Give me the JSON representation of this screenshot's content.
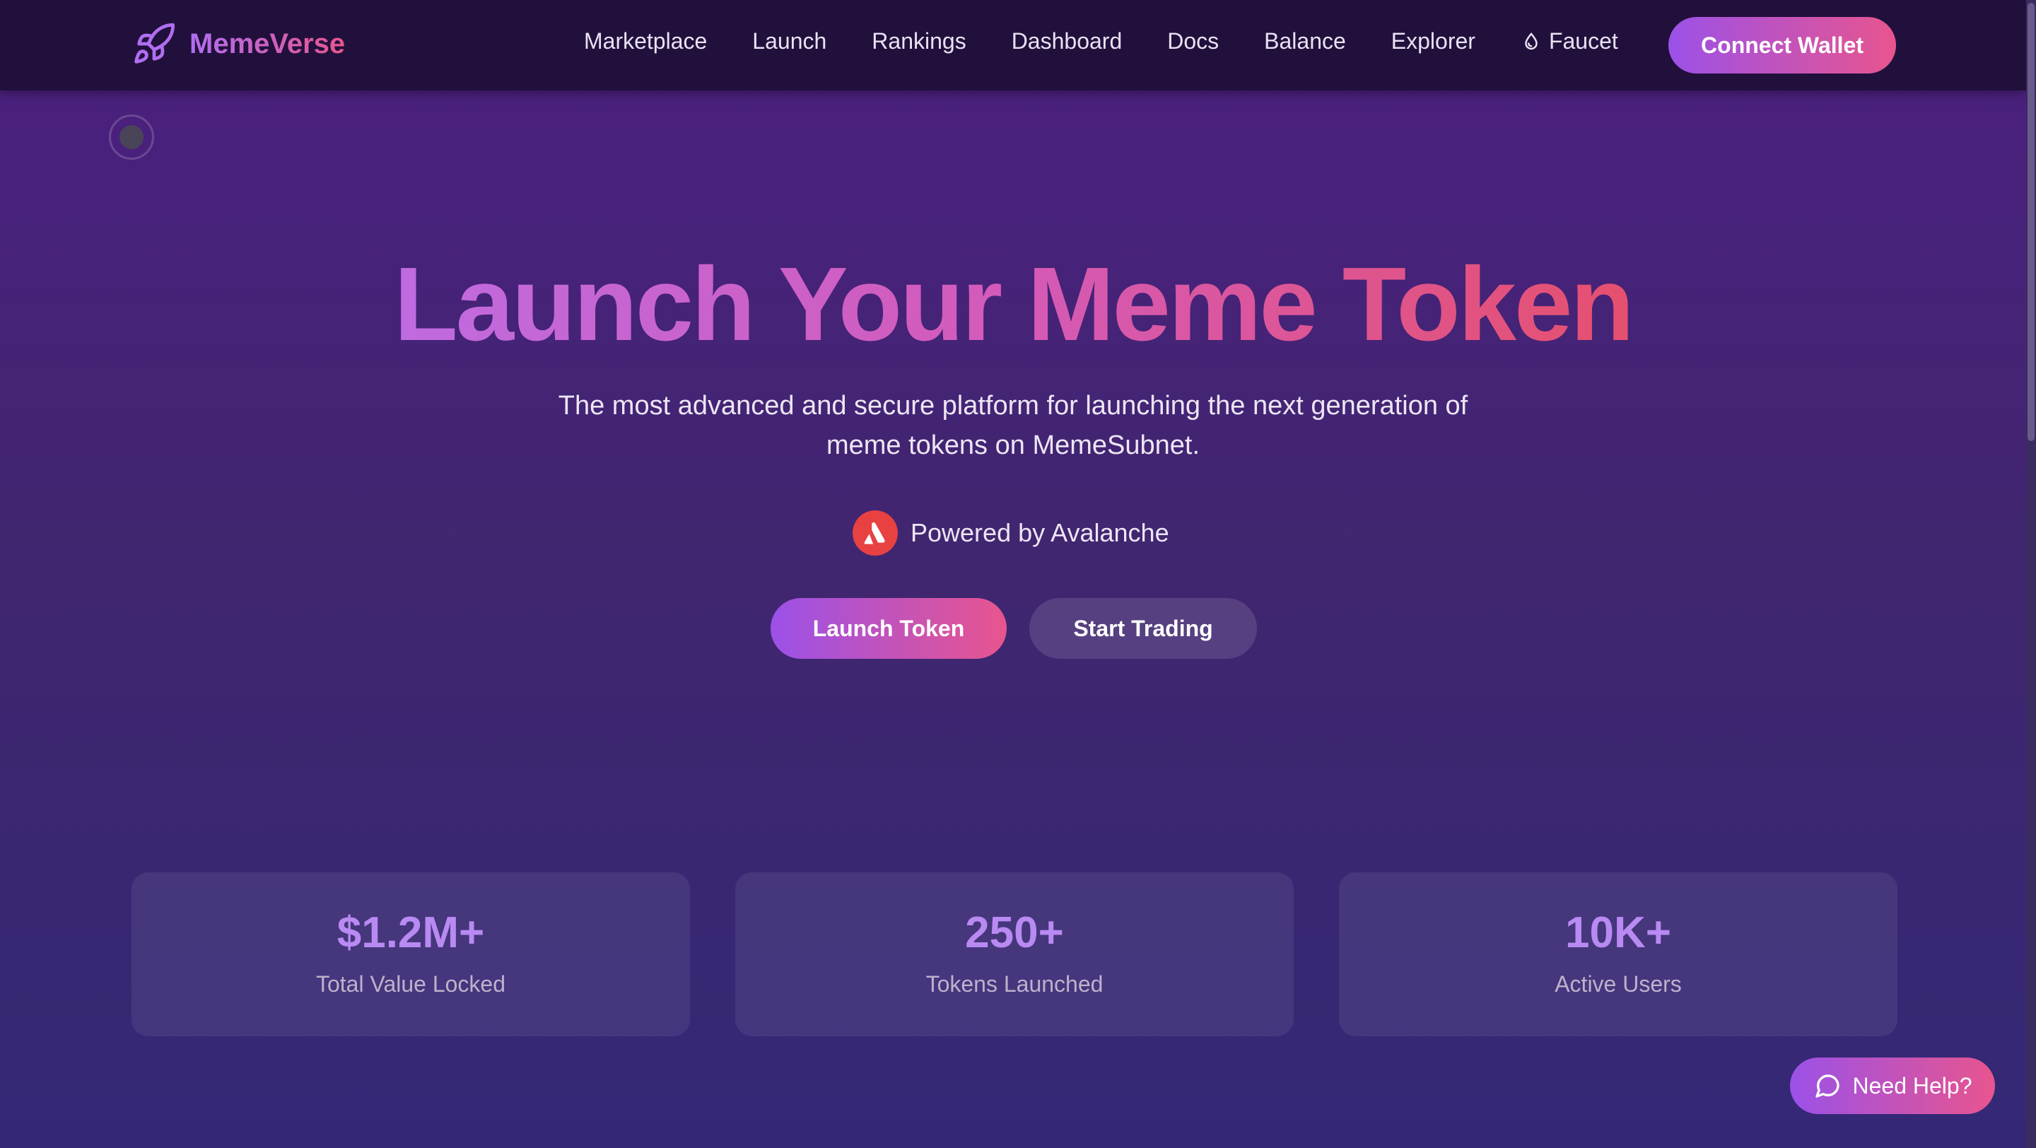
{
  "brand": {
    "name": "MemeVerse",
    "icon": "rocket-icon"
  },
  "nav": {
    "items": [
      {
        "label": "Marketplace"
      },
      {
        "label": "Launch"
      },
      {
        "label": "Rankings"
      },
      {
        "label": "Dashboard"
      },
      {
        "label": "Docs"
      },
      {
        "label": "Balance"
      },
      {
        "label": "Explorer"
      },
      {
        "label": "Faucet",
        "icon": "droplet-icon"
      }
    ],
    "connect_label": "Connect Wallet"
  },
  "hero": {
    "title": "Launch Your Meme Token",
    "subtitle": "The most advanced and secure platform for launching the next generation of meme tokens on MemeSubnet.",
    "powered_by": "Powered by Avalanche",
    "powered_icon": "avalanche-logo-icon",
    "primary_button": "Launch Token",
    "secondary_button": "Start Trading"
  },
  "stats": [
    {
      "value": "$1.2M+",
      "label": "Total Value Locked"
    },
    {
      "value": "250+",
      "label": "Tokens Launched"
    },
    {
      "value": "10K+",
      "label": "Active Users"
    }
  ],
  "help": {
    "label": "Need Help?",
    "icon": "chat-bubble-icon"
  },
  "colors": {
    "accent_start": "#9b51e8",
    "accent_end": "#e8558e",
    "nav_background": "#21103c",
    "avalanche_red": "#e84142",
    "stat_value": "#b98af2"
  }
}
